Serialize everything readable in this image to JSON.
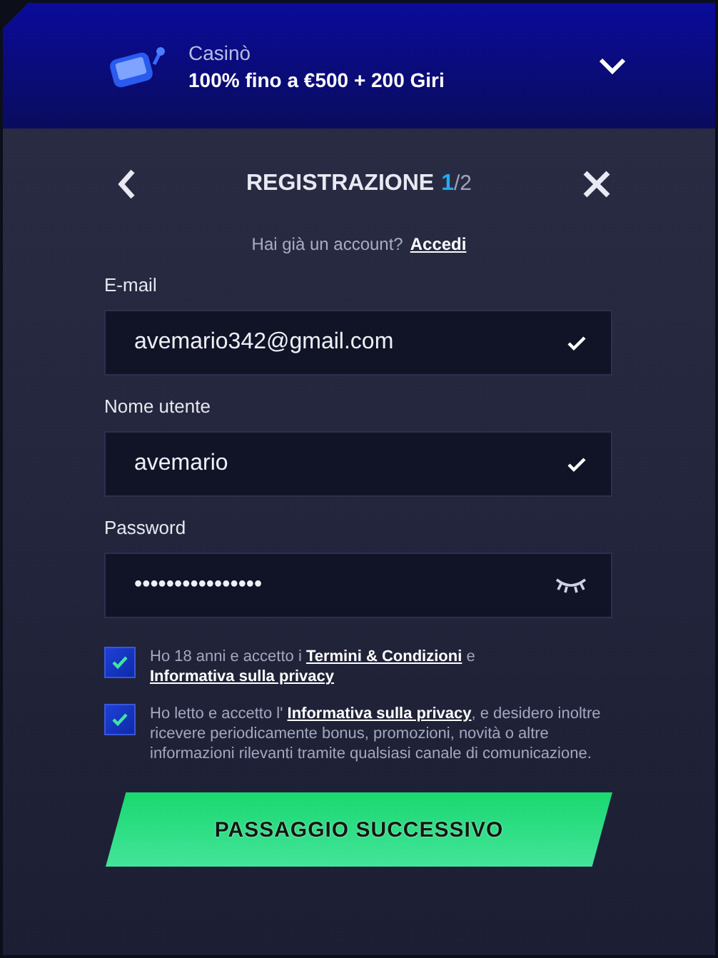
{
  "promo": {
    "category": "Casinò",
    "offer": "100% fino a €500 + 200 Giri",
    "expanded": false
  },
  "header": {
    "title": "REGISTRAZIONE",
    "step_current": "1",
    "step_total": "/2"
  },
  "login_prompt": {
    "text": "Hai già un account?",
    "link": "Accedi"
  },
  "fields": [
    {
      "label": "E-mail",
      "value": "avemario342@gmail.com",
      "kind": "valid"
    },
    {
      "label": "Nome utente",
      "value": "avemario",
      "kind": "valid"
    },
    {
      "label": "Password",
      "value": "••••••••••••••••",
      "kind": "password"
    }
  ],
  "consents": [
    {
      "checked": true,
      "parts": [
        {
          "text": "Ho 18 anni e accetto i ",
          "link": false
        },
        {
          "text": "Termini & Condizioni",
          "link": true
        },
        {
          "text": " e ",
          "link": false
        },
        {
          "text": "Informativa sulla privacy",
          "link": true
        }
      ]
    },
    {
      "checked": true,
      "parts": [
        {
          "text": "Ho letto e accetto l' ",
          "link": false
        },
        {
          "text": "Informativa sulla privacy",
          "link": true
        },
        {
          "text": ", e desidero inoltre ricevere periodicamente bonus, promozioni, novità o altre informazioni rilevanti tramite qualsiasi canale di comunicazione.",
          "link": false
        }
      ]
    }
  ],
  "submit": "PASSAGGIO SUCCESSIVO"
}
